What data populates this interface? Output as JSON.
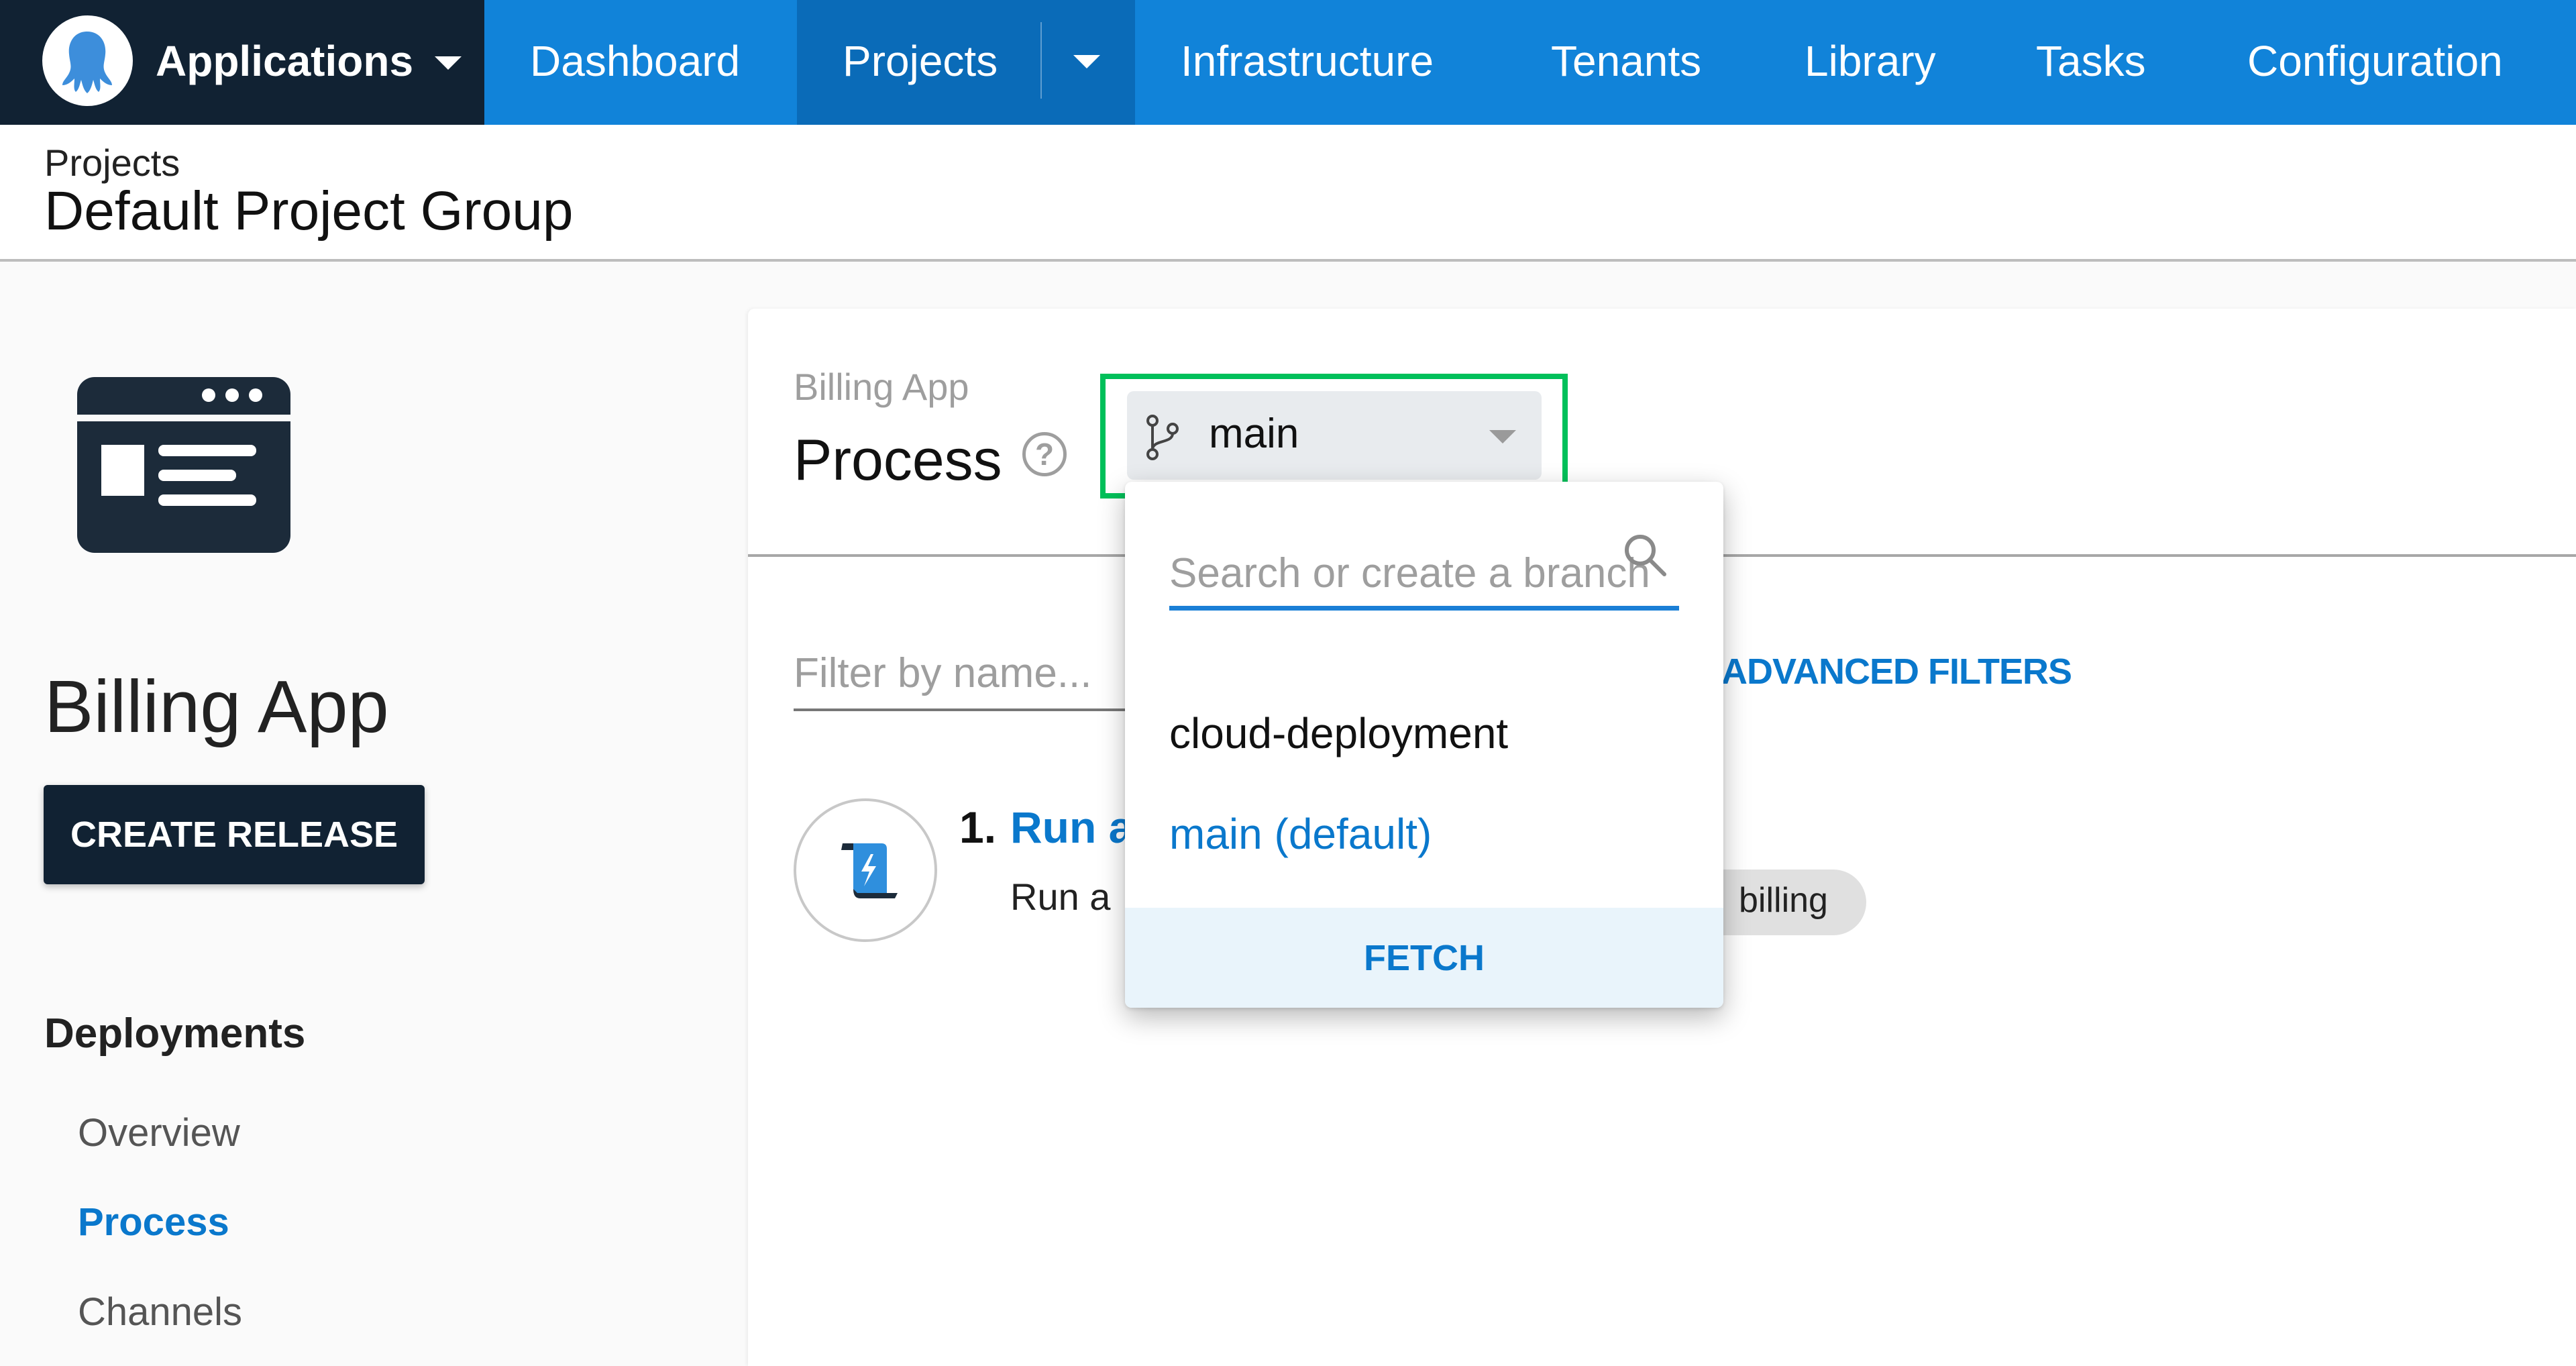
{
  "topnav": {
    "apps_label": "Applications",
    "items": [
      "Dashboard",
      "Projects",
      "Infrastructure",
      "Tenants",
      "Library",
      "Tasks",
      "Configuration"
    ],
    "active_item": "Projects",
    "colors": {
      "nav_bg": "#1183d9",
      "apps_bg": "#112233",
      "active_bg": "#0a6bb8"
    }
  },
  "header": {
    "breadcrumb": "Projects",
    "title": "Default Project Group"
  },
  "sidebar": {
    "project_icon": "browser-window-icon",
    "project_name": "Billing App",
    "create_release_label": "CREATE RELEASE",
    "section_heading": "Deployments",
    "links": [
      {
        "label": "Overview",
        "active": false
      },
      {
        "label": "Process",
        "active": true
      },
      {
        "label": "Channels",
        "active": false
      }
    ]
  },
  "main": {
    "subtitle": "Billing App",
    "title": "Process",
    "help_icon": "?",
    "branch_selector": {
      "icon": "git-branch-icon",
      "value": "main"
    },
    "filter": {
      "placeholder": "Filter by name...",
      "value": ""
    },
    "advanced_filters_label": "/ ADVANCED FILTERS",
    "steps": [
      {
        "number": "1.",
        "name": "Run a",
        "description": "Run a",
        "icon": "script-icon",
        "tag": "billing"
      }
    ]
  },
  "branch_dropdown": {
    "search_placeholder": "Search or create a branch",
    "search_value": "",
    "options": [
      {
        "label": "cloud-deployment",
        "selected": false
      },
      {
        "label": "main (default)",
        "selected": true
      }
    ],
    "fetch_label": "FETCH",
    "accent_color": "#0a78cc",
    "highlight_color": "#00c05a"
  }
}
